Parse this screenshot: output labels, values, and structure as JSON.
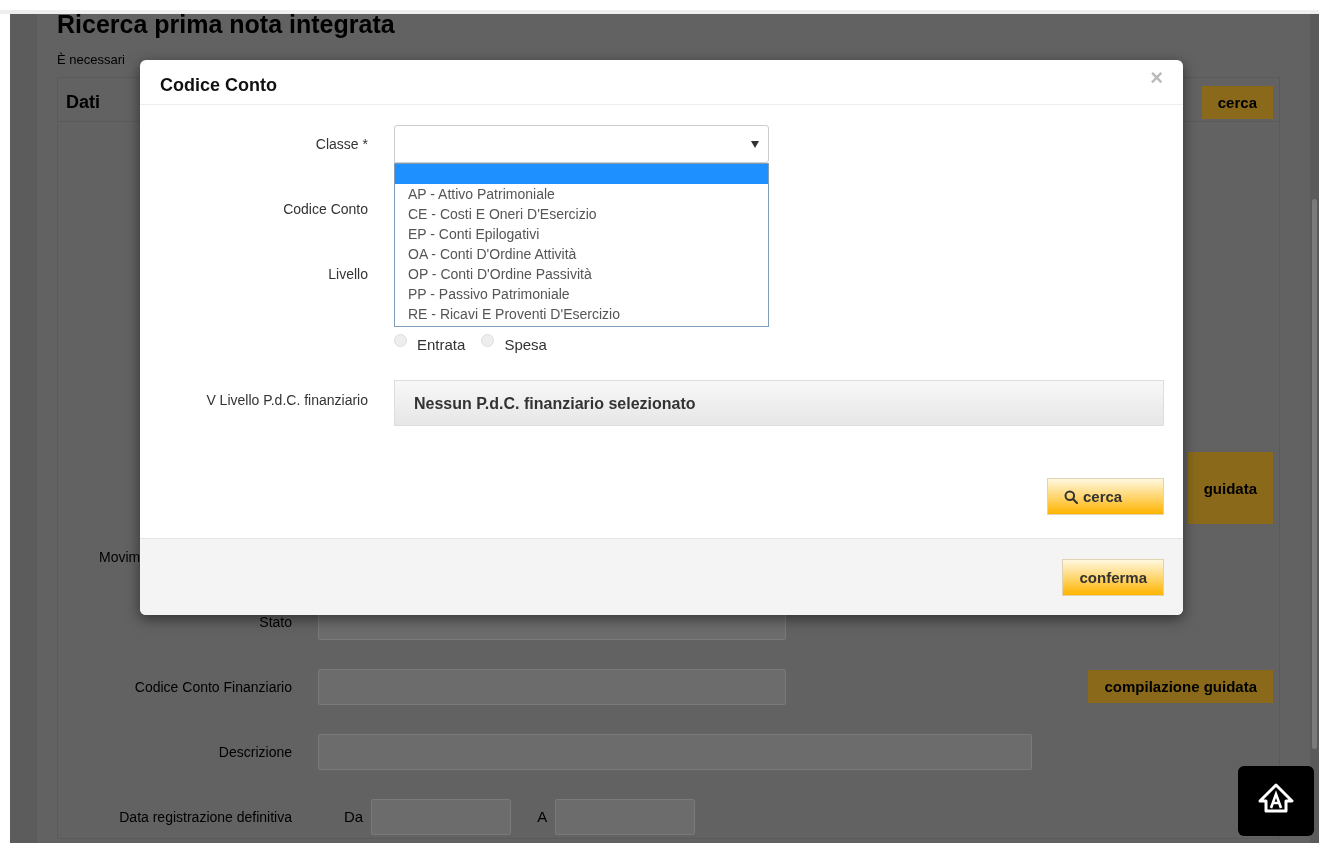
{
  "background_page": {
    "title": "Ricerca prima nota integrata",
    "notice": "È necessari",
    "section_title": "Dati",
    "search_button": "cerca",
    "guided_button": "guidata",
    "fields": [
      {
        "label": "Movim",
        "kind": "hidden"
      },
      {
        "label": "Stato",
        "kind": "select"
      },
      {
        "label": "Codice Conto Finanziario",
        "kind": "text"
      },
      {
        "label": "Descrizione",
        "kind": "wide"
      },
      {
        "label": "Data registrazione definitiva",
        "kind": "range",
        "from_label": "Da",
        "to_label": "A"
      }
    ],
    "compile_button": "compilazione guidata"
  },
  "modal": {
    "title": "Codice Conto",
    "close": "×",
    "classe": {
      "label": "Classe *",
      "expanded": true,
      "blank_option_highlighted": true,
      "options": [
        {
          "label": "AP - Attivo Patrimoniale",
          "selected": false
        },
        {
          "label": "CE - Costi E Oneri D'Esercizio",
          "selected": false
        },
        {
          "label": "EP - Conti Epilogativi",
          "selected": false
        },
        {
          "label": "OA - Conti D'Ordine Attività",
          "selected": false
        },
        {
          "label": "OP - Conti D'Ordine Passività",
          "selected": false
        },
        {
          "label": "PP - Passivo Patrimoniale",
          "selected": false
        },
        {
          "label": "RE - Ricavi E Proventi D'Esercizio",
          "selected": false
        }
      ]
    },
    "codice_conto": {
      "label": "Codice Conto"
    },
    "livello": {
      "label": "Livello"
    },
    "radios": [
      {
        "label": "Entrata",
        "checked": false
      },
      {
        "label": "Spesa",
        "checked": false
      }
    ],
    "pdc": {
      "label": "V Livello P.d.C. finanziario",
      "value": "Nessun P.d.C. finanziario selezionato"
    },
    "search_button": "cerca",
    "confirm_button": "conferma"
  }
}
